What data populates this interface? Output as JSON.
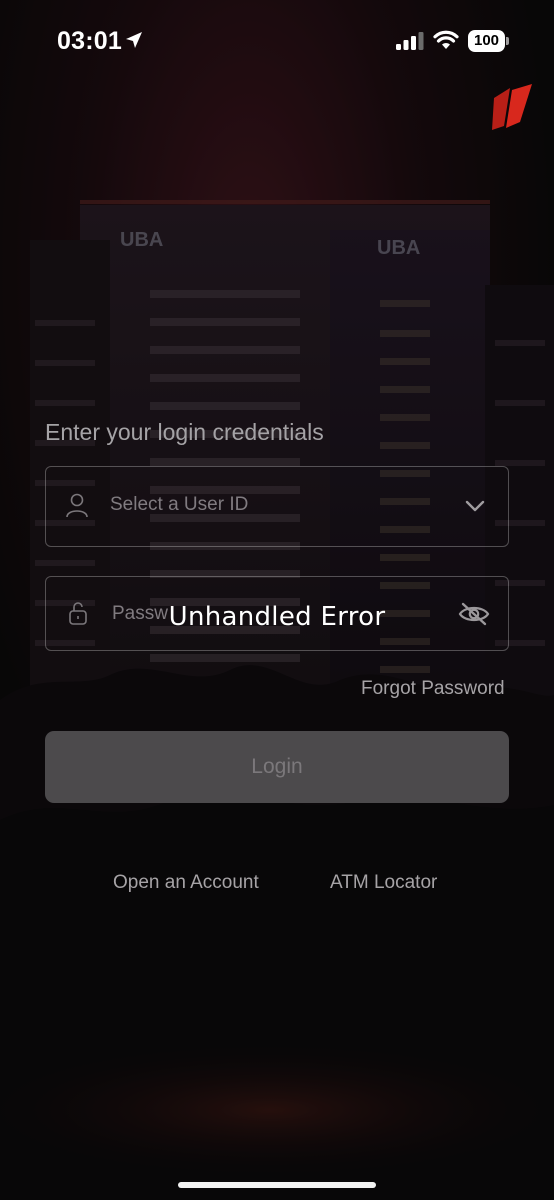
{
  "status_bar": {
    "time": "03:01",
    "location_icon": "location-arrow-icon",
    "signal_icon": "cellular-signal-icon",
    "wifi_icon": "wifi-icon",
    "battery_level": "100"
  },
  "brand": {
    "logo_icon": "uba-logo-icon",
    "background_sign_texts": [
      "UBA",
      "UBA"
    ],
    "accent_color": "#c8231b"
  },
  "login_form": {
    "title": "Enter your login credentials",
    "user_id": {
      "icon": "user-icon",
      "placeholder": "Select a User ID",
      "dropdown_icon": "chevron-down-icon"
    },
    "password": {
      "icon": "lock-icon",
      "placeholder": "Passw",
      "visibility_icon": "eye-off-icon"
    },
    "forgot_password": "Forgot Password",
    "login_button": "Login"
  },
  "footer_links": {
    "open_account": "Open an Account",
    "atm_locator": "ATM Locator"
  },
  "error_toast": {
    "message": "Unhandled Error"
  }
}
